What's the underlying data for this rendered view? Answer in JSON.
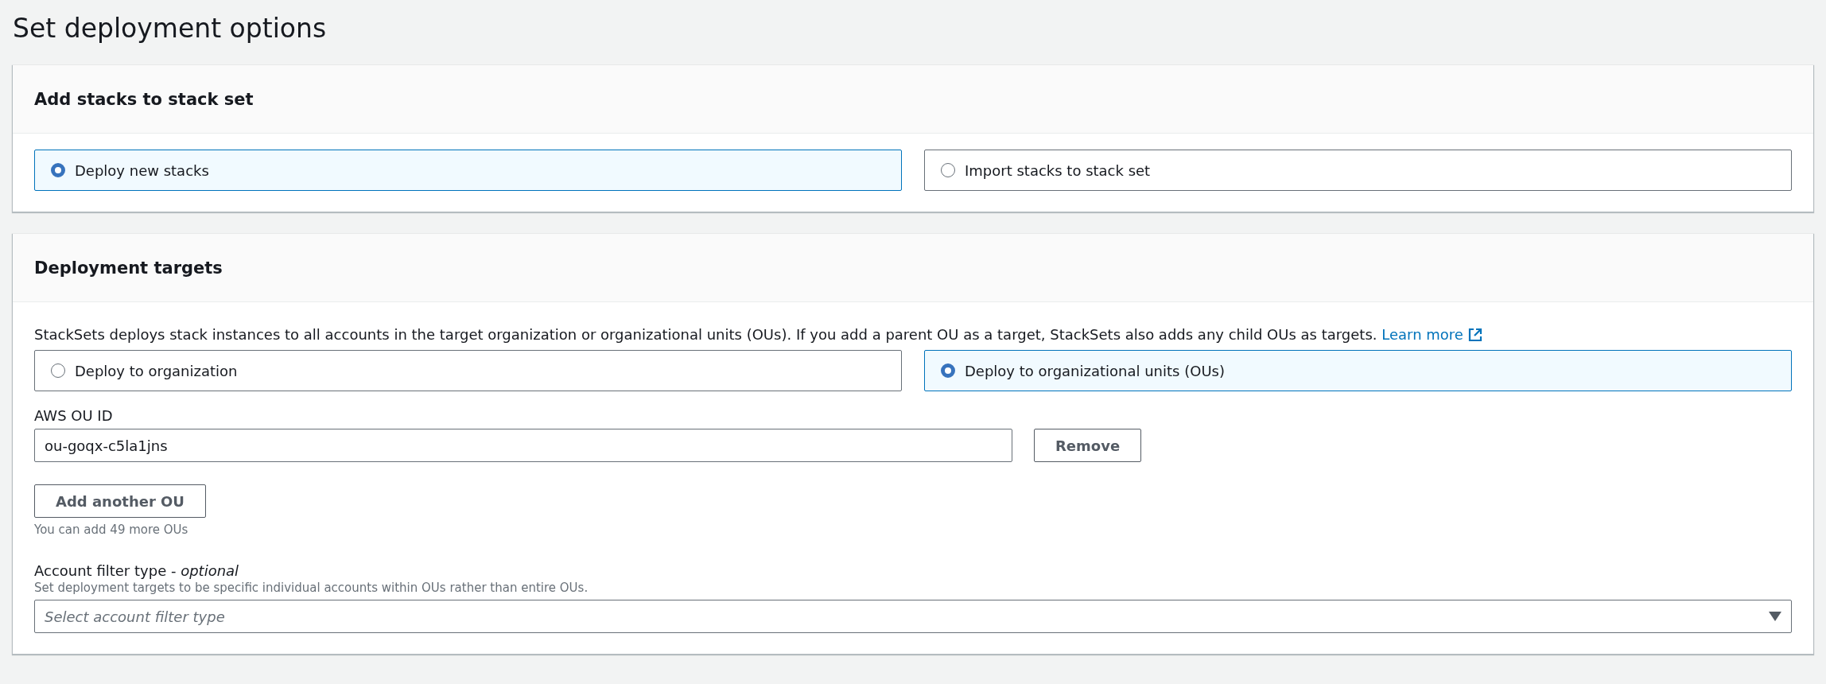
{
  "page_title": "Set deployment options",
  "add_stacks": {
    "title": "Add stacks to stack set",
    "options": [
      {
        "label": "Deploy new stacks",
        "selected": true
      },
      {
        "label": "Import stacks to stack set",
        "selected": false
      }
    ]
  },
  "deployment_targets": {
    "title": "Deployment targets",
    "description": "StackSets deploys stack instances to all accounts in the target organization or organizational units (OUs). If you add a parent OU as a target, StackSets also adds any child OUs as targets.",
    "learn_more": "Learn more",
    "options": [
      {
        "label": "Deploy to organization",
        "selected": false
      },
      {
        "label": "Deploy to organizational units (OUs)",
        "selected": true
      }
    ],
    "ou_label": "AWS OU ID",
    "ou_entries": [
      {
        "value": "ou-goqx-c5la1jns",
        "remove": "Remove"
      }
    ],
    "add_button": "Add another OU",
    "add_hint": "You can add 49 more OUs",
    "filter_label": "Account filter type - *optional*",
    "filter_description": "Set deployment targets to be specific individual accounts within OUs rather than entire OUs.",
    "filter_placeholder": "Select account filter type"
  }
}
